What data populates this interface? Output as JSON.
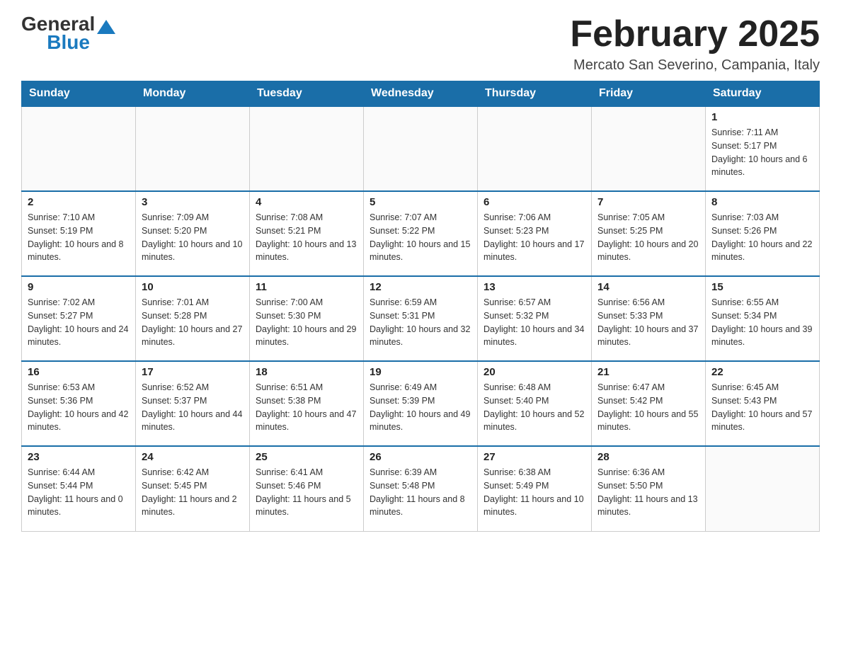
{
  "header": {
    "logo_general": "General",
    "logo_blue": "Blue",
    "month_title": "February 2025",
    "location": "Mercato San Severino, Campania, Italy"
  },
  "days_of_week": [
    "Sunday",
    "Monday",
    "Tuesday",
    "Wednesday",
    "Thursday",
    "Friday",
    "Saturday"
  ],
  "weeks": [
    [
      {
        "day": "",
        "info": ""
      },
      {
        "day": "",
        "info": ""
      },
      {
        "day": "",
        "info": ""
      },
      {
        "day": "",
        "info": ""
      },
      {
        "day": "",
        "info": ""
      },
      {
        "day": "",
        "info": ""
      },
      {
        "day": "1",
        "info": "Sunrise: 7:11 AM\nSunset: 5:17 PM\nDaylight: 10 hours and 6 minutes."
      }
    ],
    [
      {
        "day": "2",
        "info": "Sunrise: 7:10 AM\nSunset: 5:19 PM\nDaylight: 10 hours and 8 minutes."
      },
      {
        "day": "3",
        "info": "Sunrise: 7:09 AM\nSunset: 5:20 PM\nDaylight: 10 hours and 10 minutes."
      },
      {
        "day": "4",
        "info": "Sunrise: 7:08 AM\nSunset: 5:21 PM\nDaylight: 10 hours and 13 minutes."
      },
      {
        "day": "5",
        "info": "Sunrise: 7:07 AM\nSunset: 5:22 PM\nDaylight: 10 hours and 15 minutes."
      },
      {
        "day": "6",
        "info": "Sunrise: 7:06 AM\nSunset: 5:23 PM\nDaylight: 10 hours and 17 minutes."
      },
      {
        "day": "7",
        "info": "Sunrise: 7:05 AM\nSunset: 5:25 PM\nDaylight: 10 hours and 20 minutes."
      },
      {
        "day": "8",
        "info": "Sunrise: 7:03 AM\nSunset: 5:26 PM\nDaylight: 10 hours and 22 minutes."
      }
    ],
    [
      {
        "day": "9",
        "info": "Sunrise: 7:02 AM\nSunset: 5:27 PM\nDaylight: 10 hours and 24 minutes."
      },
      {
        "day": "10",
        "info": "Sunrise: 7:01 AM\nSunset: 5:28 PM\nDaylight: 10 hours and 27 minutes."
      },
      {
        "day": "11",
        "info": "Sunrise: 7:00 AM\nSunset: 5:30 PM\nDaylight: 10 hours and 29 minutes."
      },
      {
        "day": "12",
        "info": "Sunrise: 6:59 AM\nSunset: 5:31 PM\nDaylight: 10 hours and 32 minutes."
      },
      {
        "day": "13",
        "info": "Sunrise: 6:57 AM\nSunset: 5:32 PM\nDaylight: 10 hours and 34 minutes."
      },
      {
        "day": "14",
        "info": "Sunrise: 6:56 AM\nSunset: 5:33 PM\nDaylight: 10 hours and 37 minutes."
      },
      {
        "day": "15",
        "info": "Sunrise: 6:55 AM\nSunset: 5:34 PM\nDaylight: 10 hours and 39 minutes."
      }
    ],
    [
      {
        "day": "16",
        "info": "Sunrise: 6:53 AM\nSunset: 5:36 PM\nDaylight: 10 hours and 42 minutes."
      },
      {
        "day": "17",
        "info": "Sunrise: 6:52 AM\nSunset: 5:37 PM\nDaylight: 10 hours and 44 minutes."
      },
      {
        "day": "18",
        "info": "Sunrise: 6:51 AM\nSunset: 5:38 PM\nDaylight: 10 hours and 47 minutes."
      },
      {
        "day": "19",
        "info": "Sunrise: 6:49 AM\nSunset: 5:39 PM\nDaylight: 10 hours and 49 minutes."
      },
      {
        "day": "20",
        "info": "Sunrise: 6:48 AM\nSunset: 5:40 PM\nDaylight: 10 hours and 52 minutes."
      },
      {
        "day": "21",
        "info": "Sunrise: 6:47 AM\nSunset: 5:42 PM\nDaylight: 10 hours and 55 minutes."
      },
      {
        "day": "22",
        "info": "Sunrise: 6:45 AM\nSunset: 5:43 PM\nDaylight: 10 hours and 57 minutes."
      }
    ],
    [
      {
        "day": "23",
        "info": "Sunrise: 6:44 AM\nSunset: 5:44 PM\nDaylight: 11 hours and 0 minutes."
      },
      {
        "day": "24",
        "info": "Sunrise: 6:42 AM\nSunset: 5:45 PM\nDaylight: 11 hours and 2 minutes."
      },
      {
        "day": "25",
        "info": "Sunrise: 6:41 AM\nSunset: 5:46 PM\nDaylight: 11 hours and 5 minutes."
      },
      {
        "day": "26",
        "info": "Sunrise: 6:39 AM\nSunset: 5:48 PM\nDaylight: 11 hours and 8 minutes."
      },
      {
        "day": "27",
        "info": "Sunrise: 6:38 AM\nSunset: 5:49 PM\nDaylight: 11 hours and 10 minutes."
      },
      {
        "day": "28",
        "info": "Sunrise: 6:36 AM\nSunset: 5:50 PM\nDaylight: 11 hours and 13 minutes."
      },
      {
        "day": "",
        "info": ""
      }
    ]
  ]
}
